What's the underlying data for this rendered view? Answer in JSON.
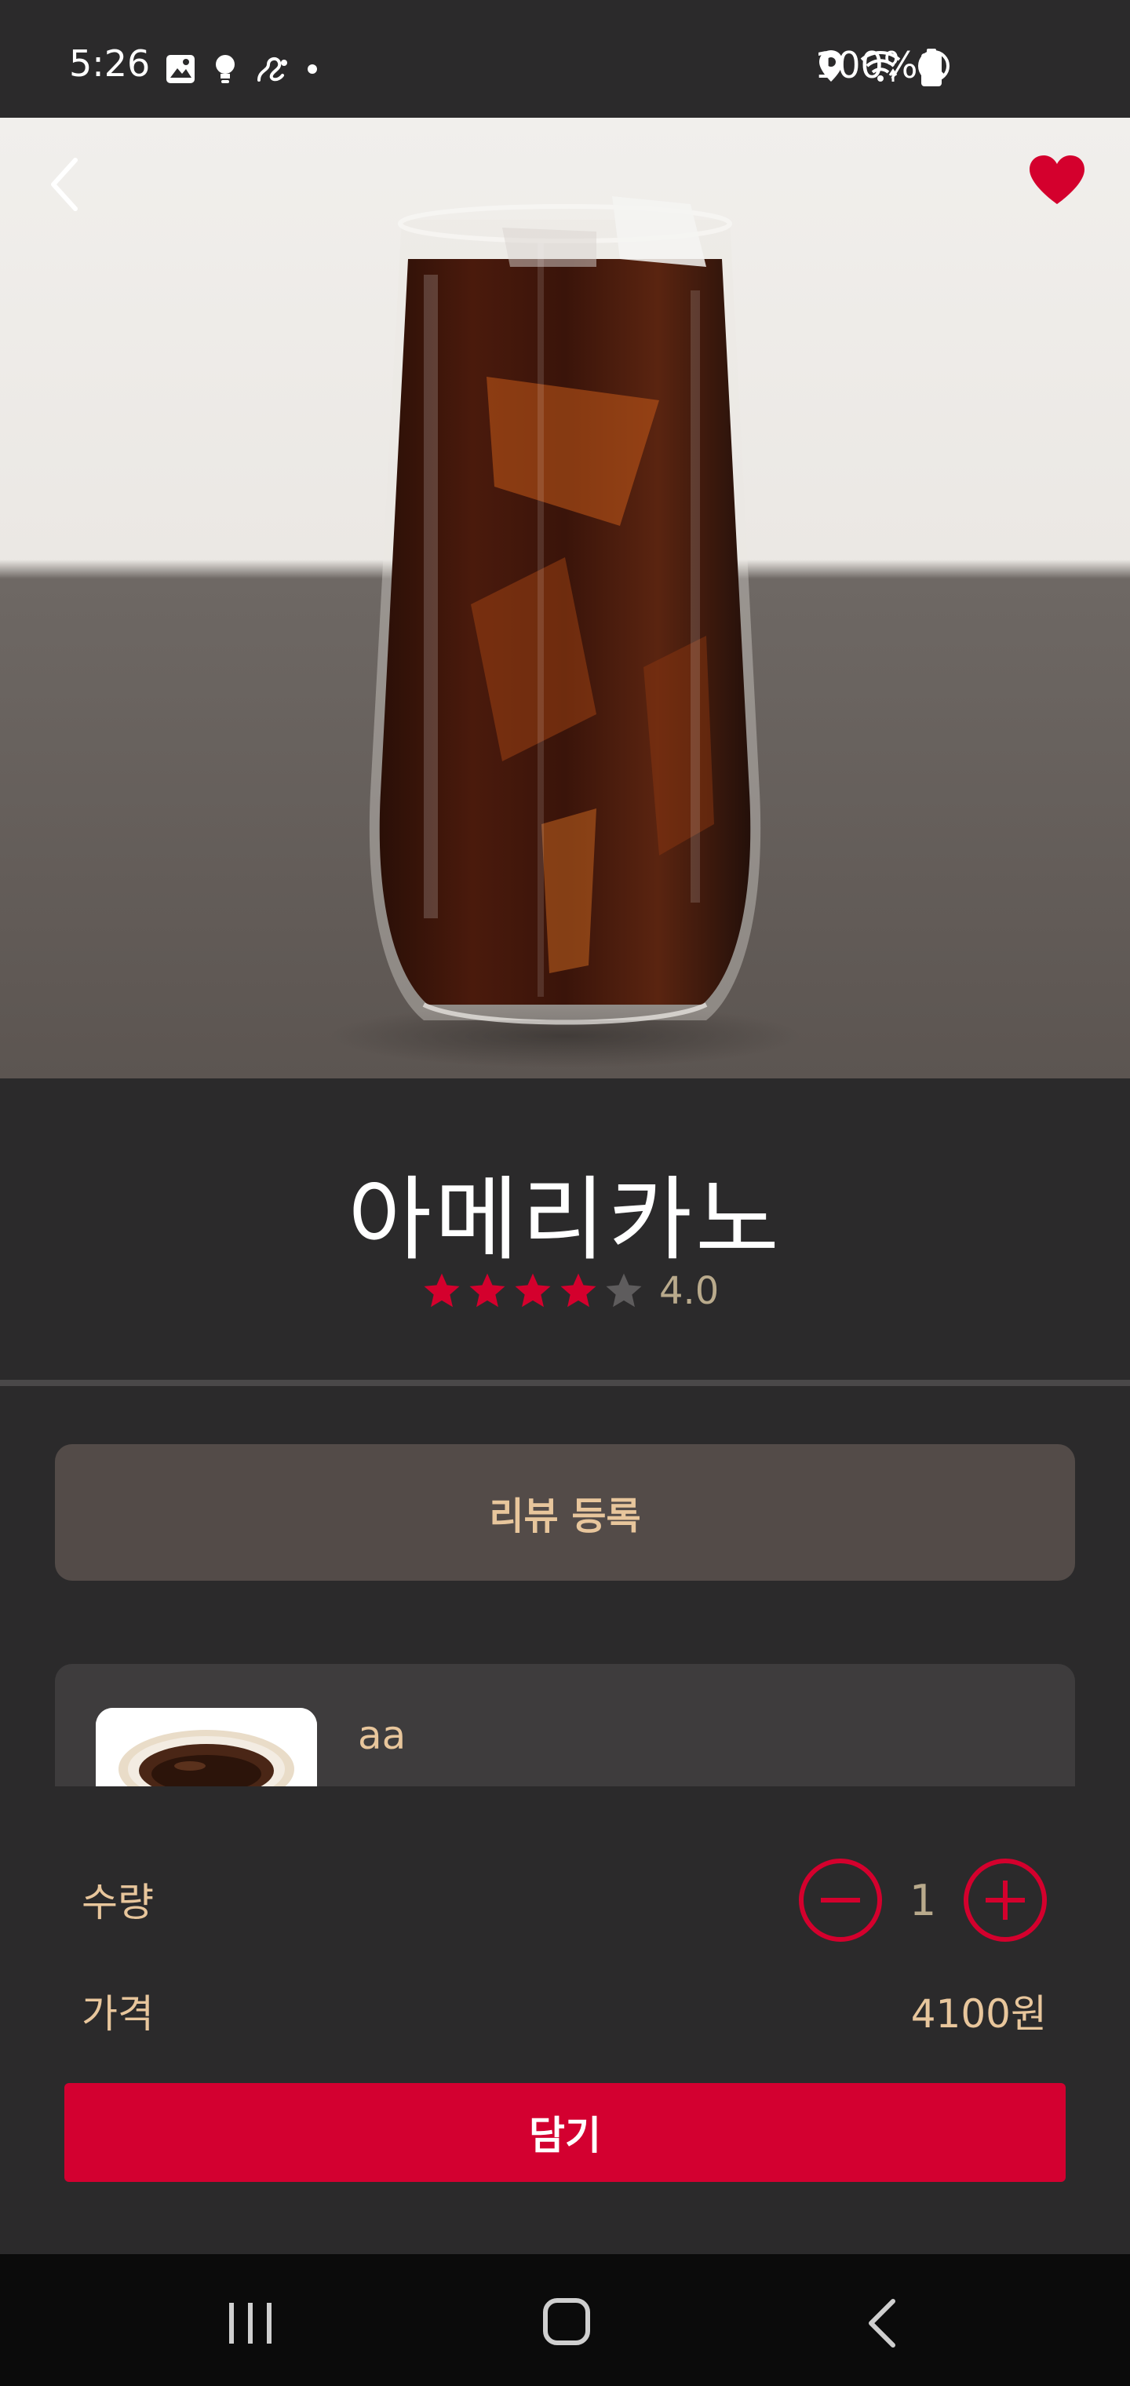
{
  "status_bar": {
    "time": "5:26",
    "battery_text": "100%",
    "icons": [
      "image-icon",
      "bulb-icon",
      "link-icon",
      "dot-icon",
      "location-icon",
      "wifi-icon",
      "do-not-disturb-icon",
      "battery-icon"
    ]
  },
  "hero": {
    "image": "iced-americano-photo",
    "back_icon": "chevron-left-icon",
    "favorite_icon": "heart-icon",
    "favorite_color": "#d4002d"
  },
  "product": {
    "name": "아메리카노",
    "rating": 4.0,
    "rating_text": "4.0",
    "stars_max": 5,
    "star_color": "#d4002d",
    "star_empty_color": "#5e5c5d"
  },
  "review_button_label": "리뷰 등록",
  "reviews": [
    {
      "author": "aa",
      "thumbnail": "hot-coffee-cup-image"
    }
  ],
  "order": {
    "quantity_label": "수량",
    "quantity": "1",
    "price_label": "가격",
    "price": "4100원",
    "add_button_label": "담기",
    "minus_icon": "minus-circle-icon",
    "plus_icon": "plus-circle-icon"
  },
  "nav_bar": {
    "icons": [
      "recents-icon",
      "home-icon",
      "back-icon"
    ]
  },
  "colors": {
    "background": "#2b2a2b",
    "accent": "#d30030",
    "text_gold": "#e8c69c",
    "review_button_bg": "#534b48"
  }
}
